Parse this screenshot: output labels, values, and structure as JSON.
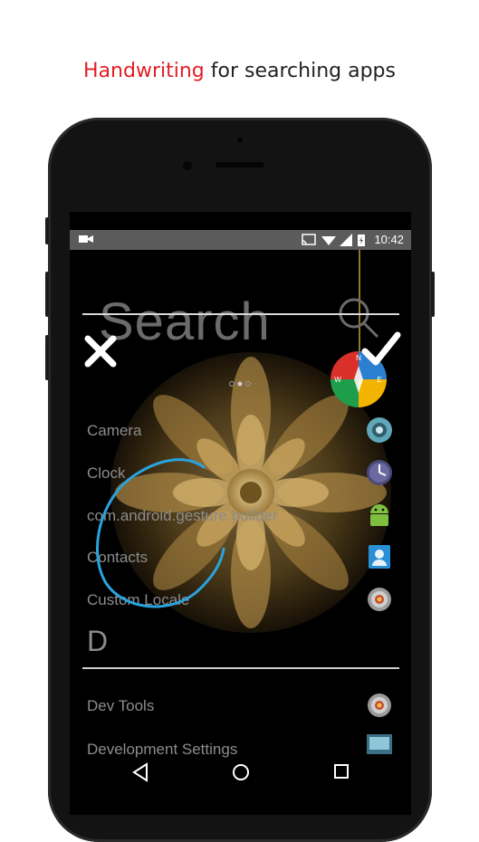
{
  "headline": {
    "accent": "Handwriting",
    "rest": " for searching apps"
  },
  "status_bar": {
    "time": "10:42",
    "icons": [
      "video-camera-icon",
      "cast-icon",
      "wifi-icon",
      "signal-icon",
      "battery-charging-icon"
    ]
  },
  "search": {
    "placeholder": "Search"
  },
  "handwriting": {
    "cancel_label": "cancel",
    "confirm_label": "confirm",
    "stroke_color": "#2aa3dd"
  },
  "apps": [
    {
      "label": "Camera",
      "icon": "camera-app-icon"
    },
    {
      "label": "Clock",
      "icon": "clock-app-icon"
    },
    {
      "label": "com.android.gesture.builder",
      "icon": "android-app-icon"
    },
    {
      "label": "Contacts",
      "icon": "contacts-app-icon"
    },
    {
      "label": "Custom Locale",
      "icon": "settings-app-icon"
    }
  ],
  "section": {
    "letter": "D"
  },
  "apps_d": [
    {
      "label": "Dev Tools",
      "icon": "settings-app-icon"
    },
    {
      "label": "Development Settings",
      "icon": "dev-settings-app-icon"
    }
  ],
  "nav": [
    "back-icon",
    "home-icon",
    "recents-icon"
  ],
  "colors": {
    "accent": "#e31e24",
    "status_bar": "#5b5b5b",
    "handwriting": "#2aa3dd"
  }
}
